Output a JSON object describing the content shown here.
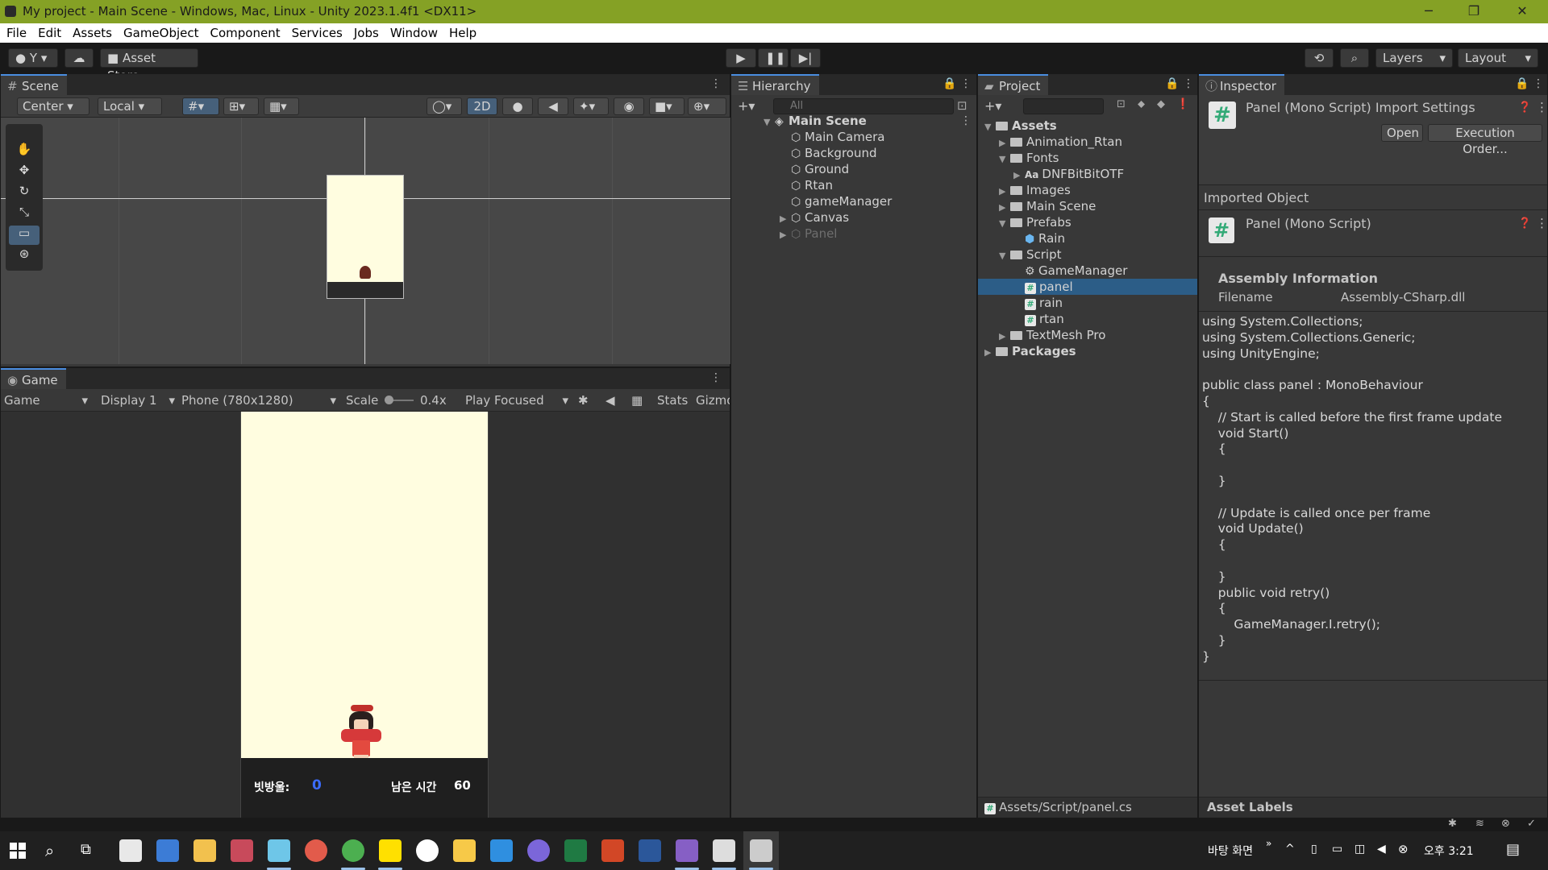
{
  "window": {
    "title": "My project - Main Scene - Windows, Mac, Linux - Unity 2023.1.4f1 <DX11>",
    "minimize": "─",
    "restore": "❐",
    "close": "✕"
  },
  "menu": [
    "File",
    "Edit",
    "Assets",
    "GameObject",
    "Component",
    "Services",
    "Jobs",
    "Window",
    "Help"
  ],
  "toolbar": {
    "account": "Y",
    "asset_store": "Asset Store",
    "layers": "Layers",
    "layout": "Layout"
  },
  "scene": {
    "tab": "Scene",
    "pivot": "Center",
    "space": "Local",
    "mode_2d": "2D"
  },
  "game": {
    "tab": "Game",
    "view": "Game",
    "display": "Display 1",
    "resolution": "Phone (780x1280)",
    "scale_label": "Scale",
    "scale_value": "0.4x",
    "play_mode": "Play Focused",
    "stats": "Stats",
    "gizmos": "Gizmo",
    "hud": {
      "score_label": "빗방울:",
      "score_value": "0",
      "time_label": "남은 시간",
      "time_value": "60"
    }
  },
  "hierarchy": {
    "tab": "Hierarchy",
    "search_placeholder": "All",
    "scene": "Main Scene",
    "items": [
      "Main Camera",
      "Background",
      "Ground",
      "Rtan",
      "gameManager",
      "Canvas",
      "Panel"
    ]
  },
  "project": {
    "tab": "Project",
    "root": "Assets",
    "tree": {
      "animation": "Animation_Rtan",
      "fonts": "Fonts",
      "font_asset": "DNFBitBitOTF",
      "images": "Images",
      "main_scene": "Main Scene",
      "prefabs": "Prefabs",
      "rain": "Rain",
      "script": "Script",
      "gamemanager": "GameManager",
      "panel": "panel",
      "rain_script": "rain",
      "rtan": "rtan",
      "textmesh": "TextMesh Pro",
      "packages": "Packages"
    },
    "path": "Assets/Script/panel.cs"
  },
  "inspector": {
    "tab": "Inspector",
    "header": "Panel (Mono Script) Import Settings",
    "open": "Open",
    "execution_order": "Execution Order...",
    "imported_object": "Imported Object",
    "object_name": "Panel (Mono Script)",
    "assembly_title": "Assembly Information",
    "filename_label": "Filename",
    "filename_value": "Assembly-CSharp.dll",
    "code": "using System.Collections;\nusing System.Collections.Generic;\nusing UnityEngine;\n\npublic class panel : MonoBehaviour\n{\n    // Start is called before the first frame update\n    void Start()\n    {\n\n    }\n\n    // Update is called once per frame\n    void Update()\n    {\n\n    }\n    public void retry()\n    {\n        GameManager.I.retry();\n    }\n}",
    "asset_labels": "Asset Labels"
  },
  "taskbar": {
    "desktop": "바탕 화면",
    "time": "오후 3:21"
  },
  "colors": {
    "titlebar": "#85a125",
    "selection": "#2c5d87",
    "game_bg": "#fffde0",
    "score": "#3b6cff"
  }
}
